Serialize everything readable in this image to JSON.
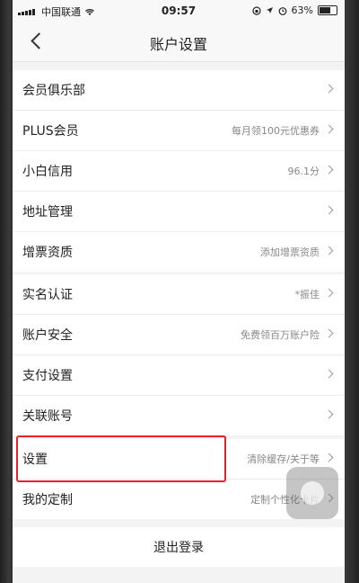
{
  "status_bar": {
    "carrier": "中国联通",
    "time": "09:57",
    "battery": "63%"
  },
  "header": {
    "title": "账户设置"
  },
  "group1": [
    {
      "label": "会员俱乐部",
      "value": ""
    },
    {
      "label": "PLUS会员",
      "value": "每月领100元优惠券"
    },
    {
      "label": "小白信用",
      "value": "96.1分"
    },
    {
      "label": "地址管理",
      "value": ""
    },
    {
      "label": "增票资质",
      "value": "添加增票资质"
    }
  ],
  "group2": [
    {
      "label": "实名认证",
      "value": "*振佳"
    },
    {
      "label": "账户安全",
      "value": "免费领百万账户险"
    },
    {
      "label": "支付设置",
      "value": ""
    },
    {
      "label": "关联账号",
      "value": ""
    }
  ],
  "group3": [
    {
      "label": "设置",
      "value": "清除缓存/关于等"
    },
    {
      "label": "我的定制",
      "value": "定制个性化卡片"
    }
  ],
  "logout_label": "退出登录",
  "colors": {
    "highlight": "#e8222b",
    "background": "#f3f3f3",
    "row": "#ffffff"
  }
}
